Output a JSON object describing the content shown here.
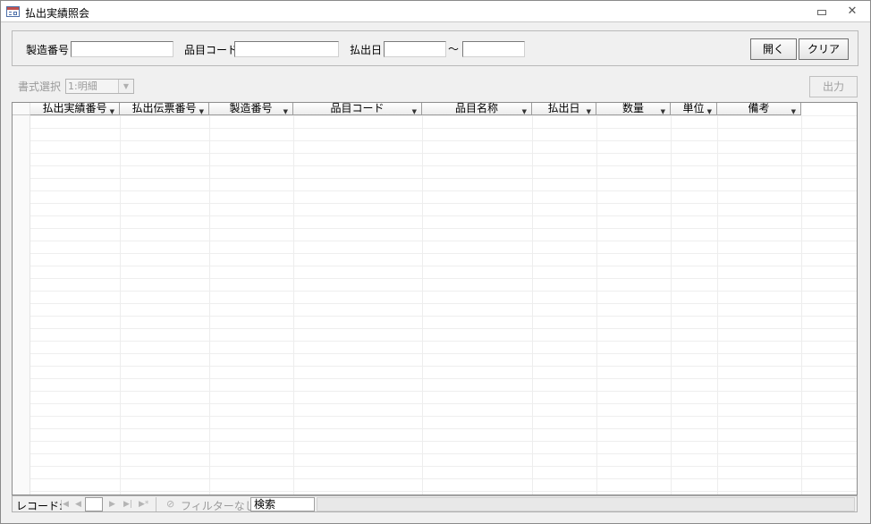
{
  "window": {
    "title": "払出実績照会"
  },
  "filters": {
    "manufacture_no_label": "製造番号",
    "manufacture_no_value": "",
    "item_code_label": "品目コード",
    "item_code_value": "",
    "payout_date_label": "払出日",
    "date_from_value": "",
    "range_separator": "～",
    "date_to_value": ""
  },
  "buttons": {
    "open": "開く",
    "clear": "クリア",
    "output": "出力"
  },
  "format": {
    "label": "書式選択",
    "selected": "1:明細"
  },
  "table": {
    "columns": [
      {
        "label": "払出実績番号"
      },
      {
        "label": "払出伝票番号"
      },
      {
        "label": "製造番号"
      },
      {
        "label": "品目コード"
      },
      {
        "label": "品目名称"
      },
      {
        "label": "払出日"
      },
      {
        "label": "数量"
      },
      {
        "label": "単位"
      },
      {
        "label": "備考"
      }
    ],
    "rows": []
  },
  "navigation": {
    "record_label": "レコード:",
    "record_value": "",
    "filter_status": "フィルターなし",
    "search_placeholder": "検索"
  }
}
